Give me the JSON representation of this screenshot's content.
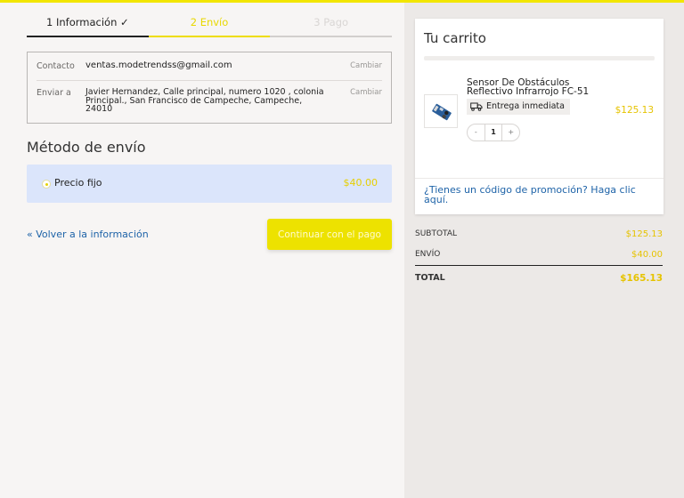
{
  "steps": [
    {
      "label": "1 Información ✓",
      "state": "completed"
    },
    {
      "label": "2 Envío",
      "state": "current"
    },
    {
      "label": "3 Pago",
      "state": "pending"
    }
  ],
  "contact": {
    "label": "Contacto",
    "value": "ventas.modetrendss@gmail.com",
    "change": "Cambiar"
  },
  "shipto": {
    "label": "Enviar a",
    "value": "Javier Hernandez, Calle principal, numero 1020 , colonia Principal., San Francisco de Campeche, Campeche, 24010",
    "change": "Cambiar"
  },
  "shipping": {
    "title": "Método de envío",
    "option_name": "Precio fijo",
    "option_price": "$40.00"
  },
  "nav": {
    "back": "« Volver a la información",
    "continue": "Continuar con el pago"
  },
  "cart": {
    "title": "Tu carrito",
    "product_name": "Sensor De Obstáculos Reflectivo Infrarrojo FC-51",
    "delivery": "Entrega inmediata",
    "price": "$125.13",
    "qty_minus": "-",
    "qty": "1",
    "qty_plus": "+",
    "promo": "¿Tienes un código de promoción? Haga clic aquí."
  },
  "totals": {
    "subtotal_label": "SUBTOTAL",
    "subtotal": "$125.13",
    "shipping_label": "ENVÍO",
    "shipping": "$40.00",
    "total_label": "TOTAL",
    "total": "$165.13"
  },
  "colors": {
    "accent": "#ede200",
    "link": "#1e63a8",
    "price": "#e6c300",
    "selected_bg": "#dbe5fb"
  }
}
